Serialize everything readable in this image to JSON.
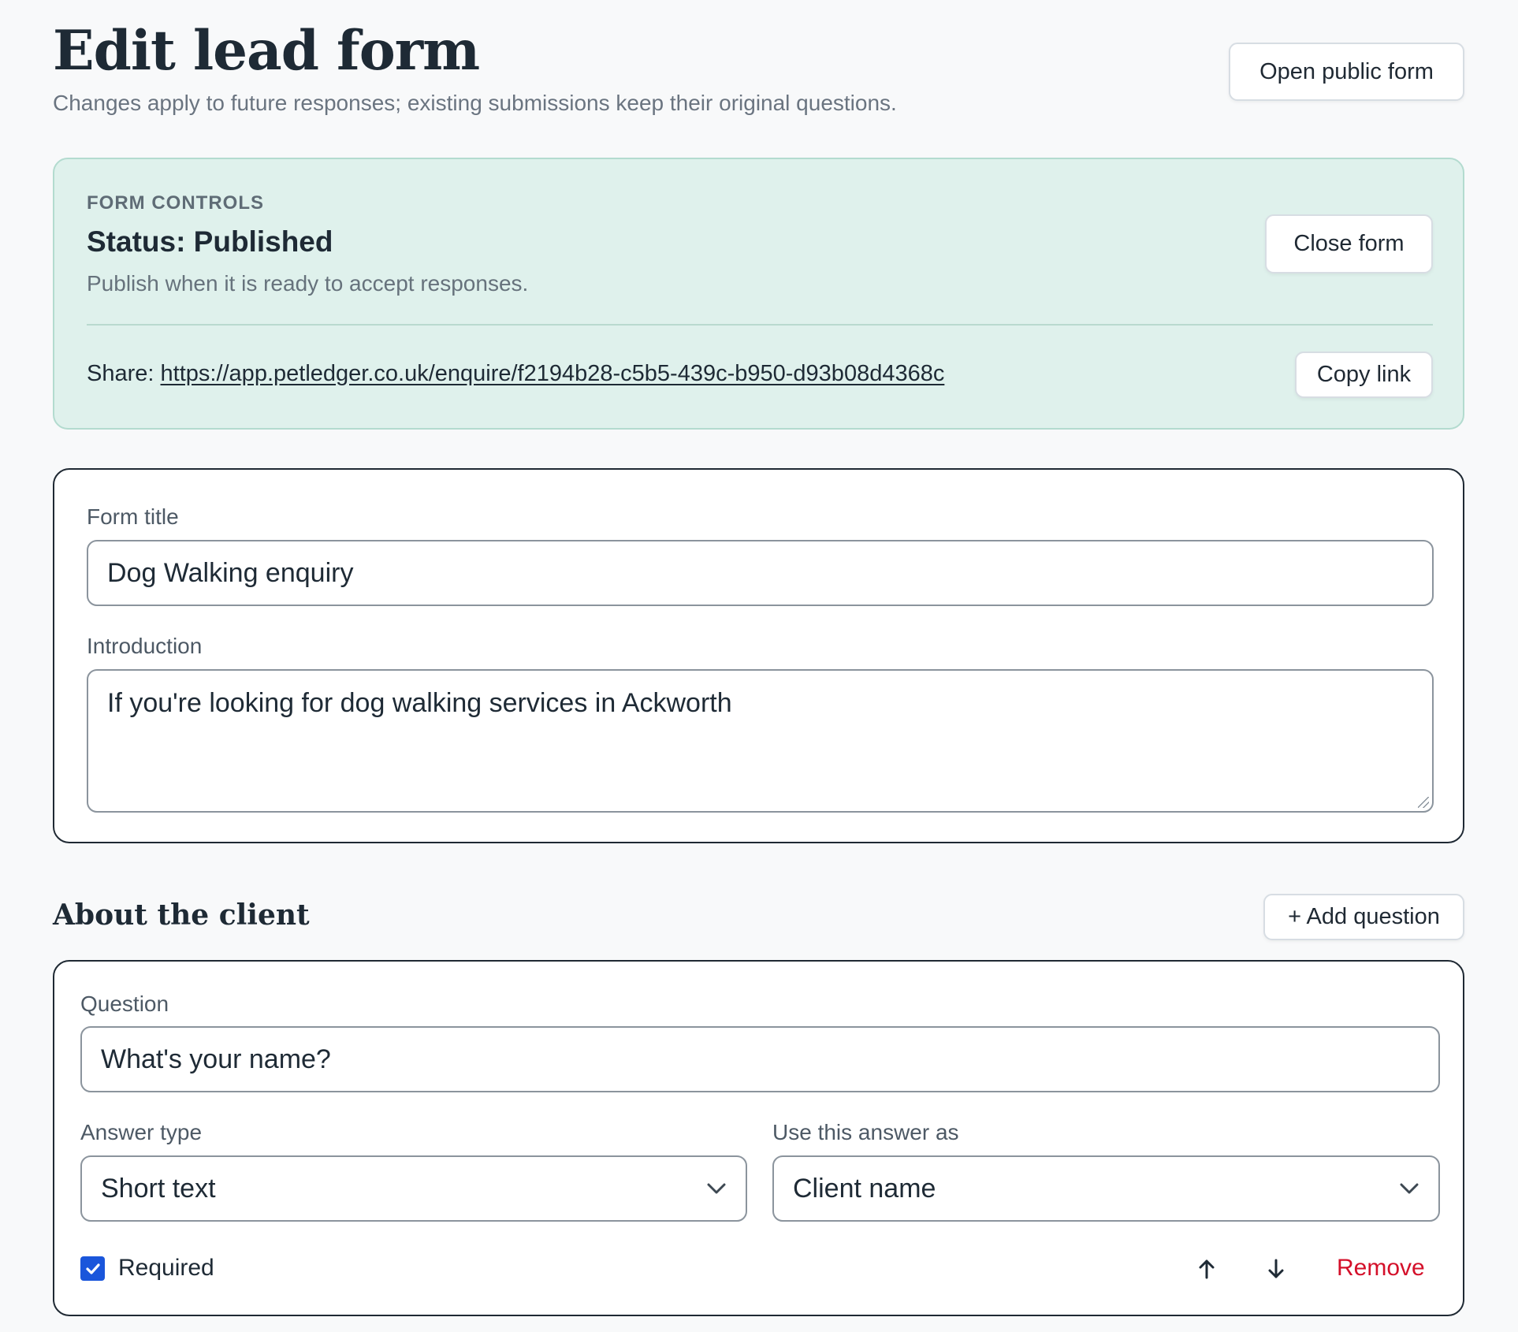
{
  "header": {
    "title": "Edit lead form",
    "subtitle": "Changes apply to future responses; existing submissions keep their original questions.",
    "open_public_form_label": "Open public form"
  },
  "controls": {
    "eyebrow": "FORM CONTROLS",
    "status": "Status: Published",
    "hint": "Publish when it is ready to accept responses.",
    "close_form_label": "Close form",
    "share_label": "Share:",
    "share_url": "https://app.petledger.co.uk/enquire/f2194b28-c5b5-439c-b950-d93b08d4368c",
    "copy_link_label": "Copy link"
  },
  "form": {
    "title_label": "Form title",
    "title_value": "Dog Walking enquiry",
    "intro_label": "Introduction",
    "intro_value": "If you're looking for dog walking services in Ackworth"
  },
  "section": {
    "title": "About the client",
    "add_question_label": "+ Add question"
  },
  "question": {
    "question_label": "Question",
    "question_value": "What's your name?",
    "answer_type_label": "Answer type",
    "answer_type_value": "Short text",
    "use_as_label": "Use this answer as",
    "use_as_value": "Client name",
    "required_label": "Required",
    "required_checked": true,
    "remove_label": "Remove"
  },
  "icons": {
    "move_up": "arrow-up-icon",
    "move_down": "arrow-down-icon",
    "select_chevron": "chevron-down-icon",
    "checkbox_check": "check-icon"
  },
  "colors": {
    "controls_bg": "#dff1ec",
    "checkbox": "#1a56db",
    "remove": "#d4102a"
  }
}
